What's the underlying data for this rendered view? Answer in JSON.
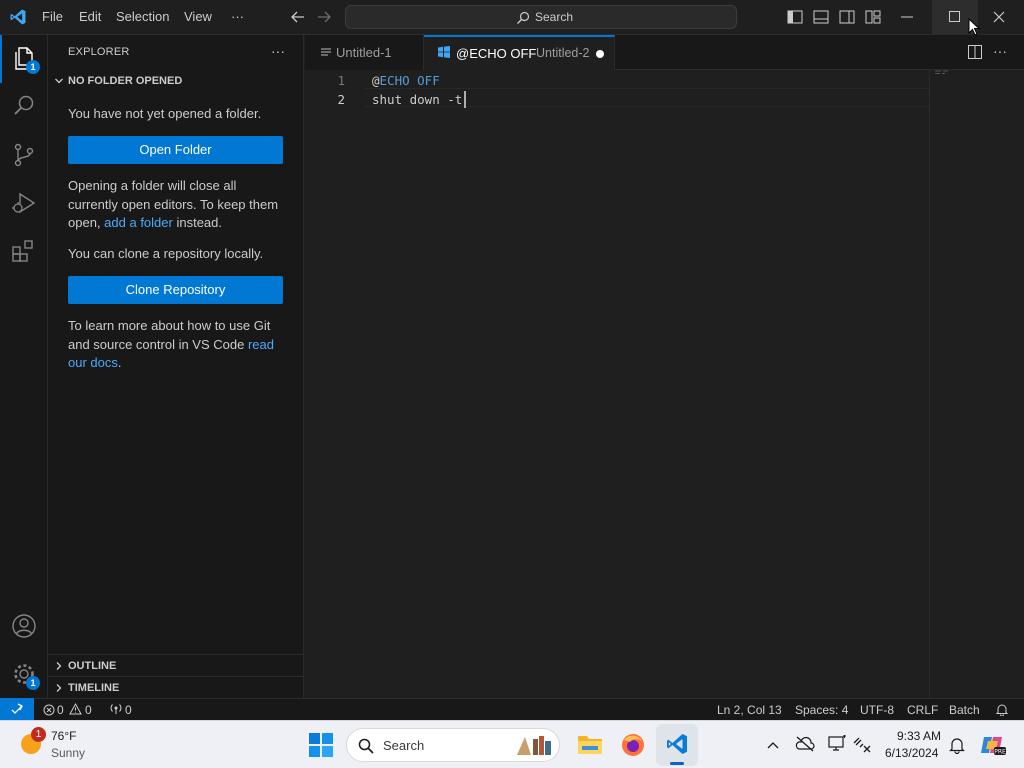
{
  "titlebar": {
    "menus": [
      "File",
      "Edit",
      "Selection",
      "View",
      "···"
    ],
    "search_placeholder": "Search"
  },
  "activity": {
    "explorer_badge": "1",
    "settings_badge": "1"
  },
  "sidebar": {
    "title": "EXPLORER",
    "more": "···",
    "section_title": "NO FOLDER OPENED",
    "no_folder_text": "You have not yet opened a folder.",
    "open_folder_label": "Open Folder",
    "opening_text_1": "Opening a folder will close all currently open editors. To keep them open,",
    "add_folder_link": "add a folder",
    "opening_text_2": "instead.",
    "clone_text": "You can clone a repository locally.",
    "clone_label": "Clone Repository",
    "learn_text": "To learn more about how to use Git and source control in VS Code",
    "read_docs_link": "read our docs",
    "learn_end": ".",
    "outline_label": "OUTLINE",
    "timeline_label": "TIMELINE"
  },
  "tabs": [
    {
      "label": "Untitled-1"
    },
    {
      "label": "@ECHO OFF",
      "description": "Untitled-2"
    }
  ],
  "editor": {
    "lines": [
      {
        "number": "1",
        "at": "@",
        "keyword": "ECHO OFF"
      },
      {
        "number": "2",
        "text": "shut down -t"
      }
    ]
  },
  "statusbar": {
    "errors": "0",
    "warnings": "0",
    "ports": "0",
    "position": "Ln 2, Col 13",
    "spaces": "Spaces: 4",
    "encoding": "UTF-8",
    "eol": "CRLF",
    "language": "Batch"
  },
  "taskbar": {
    "weather_badge": "1",
    "temperature": "76°F",
    "condition": "Sunny",
    "search_label": "Search",
    "time": "9:33 AM",
    "date": "6/13/2024"
  },
  "colors": {
    "accent": "#0078d4",
    "link": "#4daafc",
    "keyword": "#569cd6",
    "editor_bg": "#1f1f1f",
    "sidebar_bg": "#181818"
  }
}
